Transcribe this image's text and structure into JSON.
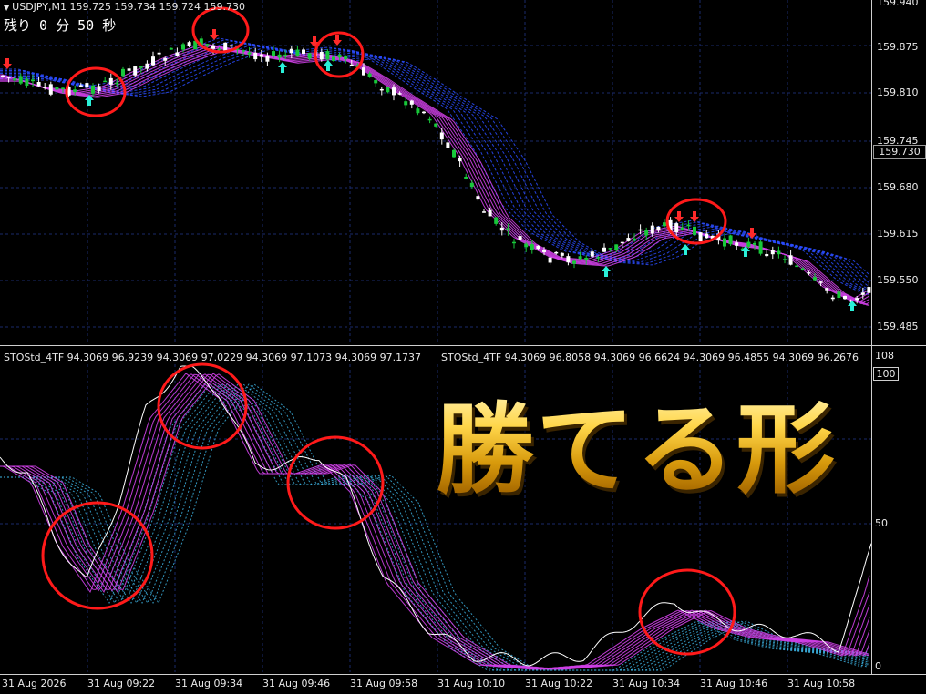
{
  "header": {
    "symbol_line": "USDJPY,M1  159.725 159.734 159.724 159.730",
    "countdown": "残り 0 分 50 秒"
  },
  "indicator_header": {
    "left": "STOStd_4TF 94.3069 96.9239 94.3069 97.0229 94.3069 97.1073 94.3069 97.1737",
    "right": "STOStd_4TF 94.3069 96.8058 94.3069 96.6624 94.3069 96.4855 94.3069 96.2676"
  },
  "price_axis": {
    "ticks": [
      "159.940",
      "159.875",
      "159.810",
      "159.745",
      "159.680",
      "159.615",
      "159.550",
      "159.485"
    ],
    "current_price": "159.730"
  },
  "osc_axis": {
    "top_label": "108",
    "box_label": "100",
    "mid_label": "50",
    "bottom_label": "0"
  },
  "time_axis": {
    "ticks": [
      "31 Aug 2026",
      "31 Aug 09:22",
      "31 Aug 09:34",
      "31 Aug 09:46",
      "31 Aug 09:58",
      "31 Aug 10:10",
      "31 Aug 10:22",
      "31 Aug 10:34",
      "31 Aug 10:46",
      "31 Aug 10:58"
    ]
  },
  "banner_text": "勝てる形",
  "colors": {
    "background": "#000000",
    "grid": "#1a2a6a",
    "bull_candle": "#18c83a",
    "bear_candle": "#ffffff",
    "ribbon_magenta": "#d040e8",
    "ribbon_blue": "#2a4cff",
    "osc_cyan": "#3fb8e8",
    "signal_up_arrow": "#2af0d8",
    "signal_down_arrow": "#ff2a2a",
    "highlight_circle": "#ff1a1a"
  },
  "icons": {
    "symbol_marker": "triangle-down-icon",
    "buy_signal": "up-arrow-icon",
    "sell_signal": "down-arrow-icon"
  }
}
